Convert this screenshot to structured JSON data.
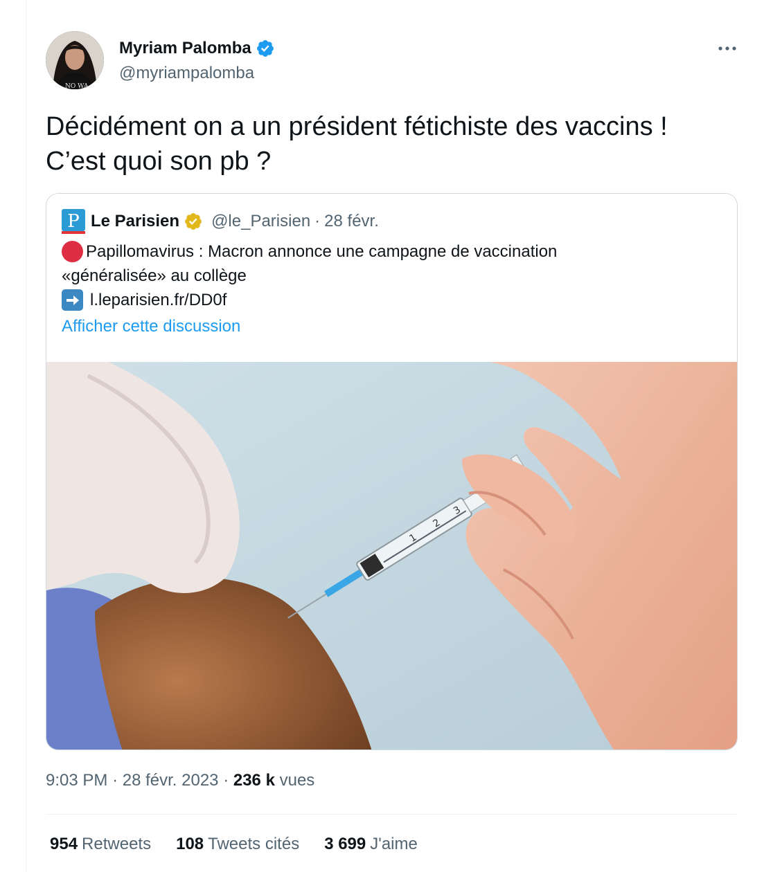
{
  "author": {
    "name": "Myriam Palomba",
    "handle": "@myriampalomba",
    "avatar_shirt_text": "NO WA"
  },
  "tweet": {
    "text": "Décidément on a un président fétichiste des vaccins !\nC’est quoi son pb ?"
  },
  "quote": {
    "logo_letter": "P",
    "name": "Le Parisien",
    "handle": "@le_Parisien",
    "separator": "·",
    "date": "28 févr.",
    "line1": "Papillomavirus : Macron annonce une campagne de vaccination",
    "line2": "«généralisée» au collège",
    "link": "l.leparisien.fr/DD0f",
    "show_thread": "Afficher cette discussion",
    "syringe_marks": [
      "1",
      "2",
      "3"
    ]
  },
  "meta": {
    "time": "9:03 PM",
    "separator": "·",
    "date": "28 févr. 2023",
    "separator2": "·",
    "views_count": "236 k",
    "views_label": "vues"
  },
  "stats": {
    "retweets_count": "954",
    "retweets_label": "Retweets",
    "quotes_count": "108",
    "quotes_label": "Tweets cités",
    "likes_count": "3 699",
    "likes_label": "J'aime"
  },
  "colors": {
    "verified_blue": "#1d9bf0",
    "verified_gold": "#e2b719",
    "link_blue": "#1d9bf0",
    "secondary_text": "#536471"
  },
  "icons": [
    "verified-badge-icon",
    "more-icon",
    "le-parisien-logo",
    "red-circle-icon",
    "right-arrow-icon",
    "gold-verified-badge-icon"
  ]
}
